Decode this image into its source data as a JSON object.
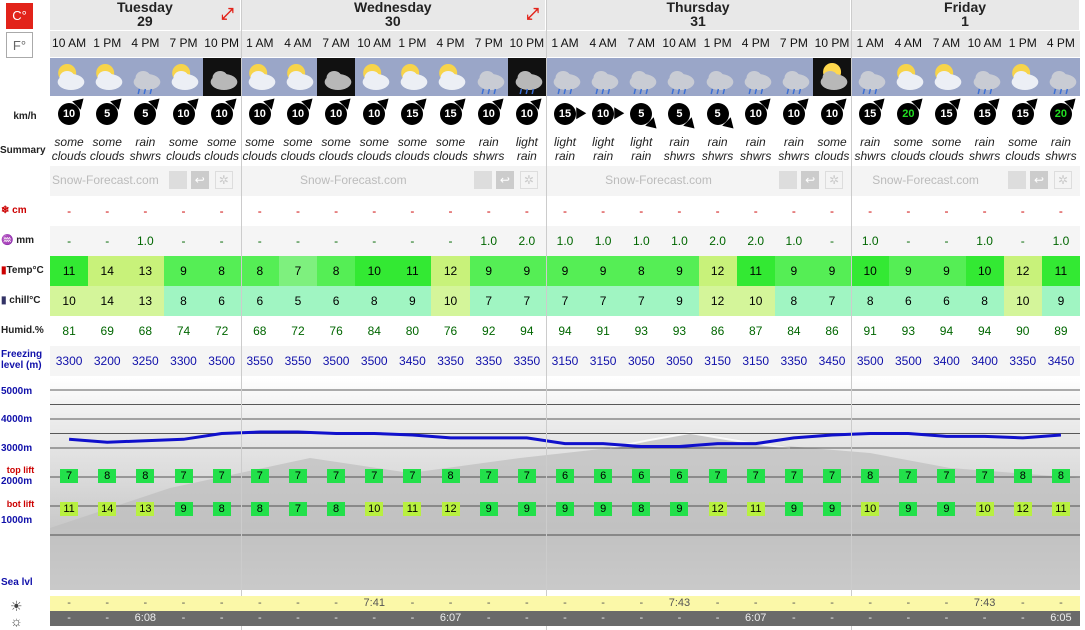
{
  "units": {
    "celsius": "C°",
    "fahrenheit": "F°"
  },
  "days": [
    {
      "name": "Tuesday",
      "date": "29"
    },
    {
      "name": "Wednesday",
      "date": "30"
    },
    {
      "name": "Thursday",
      "date": "31"
    },
    {
      "name": "Friday",
      "date": "1"
    }
  ],
  "times": [
    "10 AM",
    "1 PM",
    "4 PM",
    "7 PM",
    "10 PM",
    "1 AM",
    "4 AM",
    "7 AM",
    "10 AM",
    "1 PM",
    "4 PM",
    "7 PM",
    "10 PM",
    "1 AM",
    "4 AM",
    "7 AM",
    "10 AM",
    "1 PM",
    "4 PM",
    "7 PM",
    "10 PM",
    "1 AM",
    "4 AM",
    "7 AM",
    "10 AM",
    "1 PM",
    "4 PM"
  ],
  "weather_icons": [
    "sun-cloud",
    "sun-cloud",
    "rain-cloud",
    "sun-cloud",
    "night-cloud",
    "sun-cloud",
    "sun-cloud",
    "night-cloud",
    "sun-cloud",
    "sun-cloud",
    "sun-cloud",
    "rain-cloud",
    "dark-rain",
    "rain-cloud",
    "rain-cloud",
    "rain-cloud",
    "rain-cloud",
    "rain-cloud",
    "rain-cloud",
    "rain-cloud",
    "night-moon",
    "rain-cloud",
    "sun-cloud",
    "sun-cloud",
    "rain-cloud",
    "sun-cloud",
    "rain-cloud"
  ],
  "labels": {
    "wind": "km/h",
    "summary": "Summary",
    "snow": "cm",
    "rain": "mm",
    "temp": "Temp°C",
    "chill": "chill°C",
    "humid": "Humid.%",
    "freezing": "Freezing level (m)",
    "top_lift": "top lift",
    "bot_lift": "bot lift",
    "sea": "Sea lvl",
    "brand": "Snow-Forecast.com"
  },
  "wind_speed": [
    "10",
    "5",
    "5",
    "10",
    "10",
    "10",
    "10",
    "10",
    "10",
    "15",
    "15",
    "10",
    "10",
    "15",
    "10",
    "5",
    "5",
    "5",
    "10",
    "10",
    "10",
    "15",
    "20",
    "15",
    "15",
    "15",
    "20"
  ],
  "wind_dir_deg": [
    45,
    45,
    45,
    45,
    45,
    45,
    45,
    45,
    45,
    45,
    45,
    45,
    45,
    90,
    90,
    135,
    135,
    135,
    45,
    45,
    45,
    45,
    45,
    45,
    45,
    45,
    45
  ],
  "summary": [
    "some clouds",
    "some clouds",
    "rain shwrs",
    "some clouds",
    "some clouds",
    "some clouds",
    "some clouds",
    "some clouds",
    "some clouds",
    "some clouds",
    "some clouds",
    "rain shwrs",
    "light rain",
    "light rain",
    "light rain",
    "light rain",
    "rain shwrs",
    "rain shwrs",
    "rain shwrs",
    "rain shwrs",
    "some clouds",
    "rain shwrs",
    "some clouds",
    "some clouds",
    "rain shwrs",
    "some clouds",
    "rain shwrs"
  ],
  "snow": [
    "-",
    "-",
    "-",
    "-",
    "-",
    "-",
    "-",
    "-",
    "-",
    "-",
    "-",
    "-",
    "-",
    "-",
    "-",
    "-",
    "-",
    "-",
    "-",
    "-",
    "-",
    "-",
    "-",
    "-",
    "-",
    "-",
    "-"
  ],
  "rain": [
    "-",
    "-",
    "1.0",
    "-",
    "-",
    "-",
    "-",
    "-",
    "-",
    "-",
    "-",
    "1.0",
    "2.0",
    "1.0",
    "1.0",
    "1.0",
    "1.0",
    "2.0",
    "2.0",
    "1.0",
    "-",
    "1.0",
    "-",
    "-",
    "1.0",
    "-",
    "1.0"
  ],
  "temp": [
    "11",
    "14",
    "13",
    "9",
    "8",
    "8",
    "7",
    "8",
    "10",
    "11",
    "12",
    "9",
    "9",
    "9",
    "9",
    "8",
    "9",
    "12",
    "11",
    "9",
    "9",
    "10",
    "9",
    "9",
    "10",
    "12",
    "11"
  ],
  "chill": [
    "10",
    "14",
    "13",
    "8",
    "6",
    "6",
    "5",
    "6",
    "8",
    "9",
    "10",
    "7",
    "7",
    "7",
    "7",
    "7",
    "9",
    "12",
    "10",
    "8",
    "7",
    "8",
    "6",
    "6",
    "8",
    "10",
    "9"
  ],
  "humid": [
    "81",
    "69",
    "68",
    "74",
    "72",
    "68",
    "72",
    "76",
    "84",
    "80",
    "76",
    "92",
    "94",
    "94",
    "91",
    "93",
    "93",
    "86",
    "87",
    "84",
    "86",
    "91",
    "93",
    "94",
    "94",
    "90",
    "89"
  ],
  "freezing": [
    "3300",
    "3200",
    "3250",
    "3300",
    "3500",
    "3550",
    "3550",
    "3500",
    "3500",
    "3450",
    "3350",
    "3350",
    "3350",
    "3150",
    "3150",
    "3050",
    "3050",
    "3150",
    "3150",
    "3350",
    "3450",
    "3500",
    "3500",
    "3400",
    "3400",
    "3350",
    "3450"
  ],
  "top_lift": [
    "7",
    "8",
    "8",
    "7",
    "7",
    "7",
    "7",
    "7",
    "7",
    "7",
    "8",
    "7",
    "7",
    "6",
    "6",
    "6",
    "6",
    "7",
    "7",
    "7",
    "7",
    "8",
    "7",
    "7",
    "7",
    "8",
    "8"
  ],
  "bot_lift": [
    "11",
    "14",
    "13",
    "9",
    "8",
    "8",
    "7",
    "8",
    "10",
    "11",
    "12",
    "9",
    "9",
    "9",
    "9",
    "8",
    "9",
    "12",
    "11",
    "9",
    "9",
    "10",
    "9",
    "9",
    "10",
    "12",
    "11"
  ],
  "alt_labels": [
    "5000m",
    "4000m",
    "3000m",
    "2000m",
    "1000m"
  ],
  "sunrise": [
    "-",
    "-",
    "-",
    "-",
    "-",
    "-",
    "-",
    "-",
    "7:41",
    "-",
    "-",
    "-",
    "-",
    "-",
    "-",
    "-",
    "7:43",
    "-",
    "-",
    "-",
    "-",
    "-",
    "-",
    "-",
    "7:43",
    "-",
    "-"
  ],
  "sunset": [
    "-",
    "-",
    "6:08",
    "-",
    "-",
    "-",
    "-",
    "-",
    "-",
    "-",
    "6:07",
    "-",
    "-",
    "-",
    "-",
    "-",
    "-",
    "-",
    "6:07",
    "-",
    "-",
    "-",
    "-",
    "-",
    "-",
    "-",
    "6:05"
  ],
  "colors": {
    "red": "#e2231a",
    "green_bright": "#1fe51f",
    "green": "#4cf04c",
    "green_light": "#9cf7b6",
    "yellow": "#ccf07a",
    "blue": "#1010cc"
  }
}
